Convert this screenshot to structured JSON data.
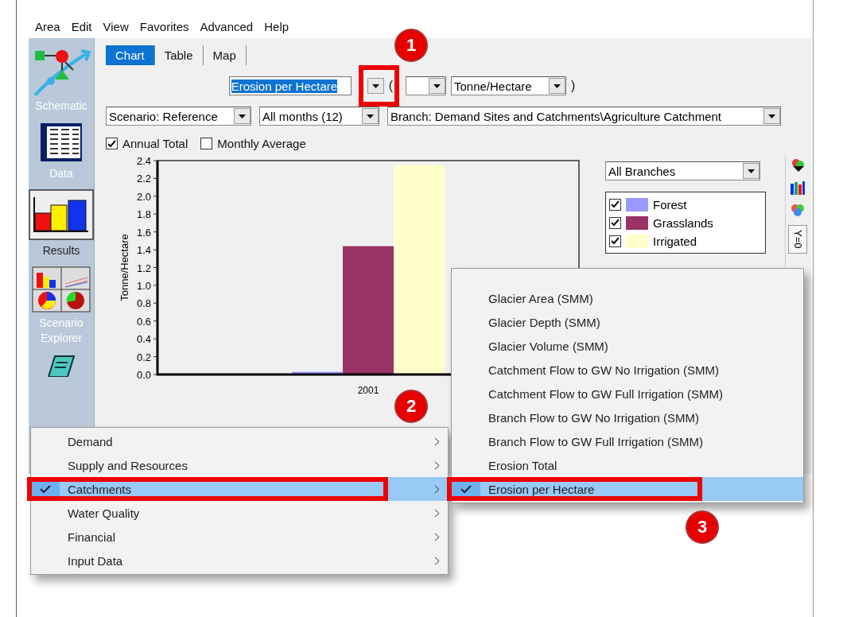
{
  "menu_bar": [
    "Area",
    "Edit",
    "View",
    "Favorites",
    "Advanced",
    "Help"
  ],
  "sidebar": [
    {
      "label": "Schematic",
      "selected": false,
      "kind": "schematic"
    },
    {
      "label": "Data",
      "selected": false,
      "kind": "data"
    },
    {
      "label": "Results",
      "selected": true,
      "kind": "results"
    },
    {
      "label": "Scenario Explorer",
      "selected": false,
      "kind": "explorer"
    }
  ],
  "tabs": [
    {
      "label": "Chart",
      "selected": true
    },
    {
      "label": "Table",
      "selected": false
    },
    {
      "label": "Map",
      "selected": false
    }
  ],
  "variable": {
    "value": "Erosion per Hectare"
  },
  "open_paren": "(",
  "unit": {
    "value": "Tonne/Hectare"
  },
  "close_paren": ")",
  "filters": [
    {
      "value": "Scenario: Reference"
    },
    {
      "value": "All months (12)"
    },
    {
      "value": "Branch: Demand Sites and Catchments\\Agriculture Catchment"
    }
  ],
  "options": [
    {
      "label": "Annual Total",
      "checked": true
    },
    {
      "label": "Monthly Average",
      "checked": false
    }
  ],
  "chart": {
    "chart_data": {
      "type": "bar",
      "ylabel": "Tonne/Hectare",
      "categories": [
        "2001"
      ],
      "series": [
        {
          "name": "Forest",
          "color": "#9999ff",
          "values": [
            0.03
          ]
        },
        {
          "name": "Grasslands",
          "color": "#993366",
          "values": [
            1.44
          ]
        },
        {
          "name": "Irrigated",
          "color": "#ffffcc",
          "values": [
            2.35
          ]
        }
      ],
      "ylim": [
        0,
        2.4
      ],
      "yticks": [
        {
          "value": 0,
          "label": "0.0"
        },
        {
          "value": 0.2,
          "label": "0.2"
        },
        {
          "value": 0.4,
          "label": "0.4"
        },
        {
          "value": 0.6,
          "label": "0.6"
        },
        {
          "value": 0.8,
          "label": "0.8"
        },
        {
          "value": 1,
          "label": "1.0"
        },
        {
          "value": 1.2,
          "label": "1.2"
        },
        {
          "value": 1.4,
          "label": "1.4"
        },
        {
          "value": 1.6,
          "label": "1.6"
        },
        {
          "value": 1.8,
          "label": "1.8"
        },
        {
          "value": 2,
          "label": "2.0"
        },
        {
          "value": 2.2,
          "label": "2.2"
        },
        {
          "value": 2.4,
          "label": "2.4"
        }
      ]
    }
  },
  "branch_filter": {
    "value": "All Branches"
  },
  "legend": [
    {
      "checked": true
    },
    {
      "checked": true
    },
    {
      "checked": true
    }
  ],
  "side_tab": "Y=0",
  "category_menu": [
    {
      "label": "Demand",
      "selected": false
    },
    {
      "label": "Supply and Resources",
      "selected": false
    },
    {
      "label": "Catchments",
      "selected": true
    },
    {
      "label": "Water Quality",
      "selected": false
    },
    {
      "label": "Financial",
      "selected": false
    },
    {
      "label": "Input Data",
      "selected": false
    }
  ],
  "variable_menu": [
    {
      "label": "Glacier Area (SMM)",
      "selected": false
    },
    {
      "label": "Glacier Depth (SMM)",
      "selected": false
    },
    {
      "label": "Glacier Volume (SMM)",
      "selected": false
    },
    {
      "label": "Catchment Flow to GW No Irrigation (SMM)",
      "selected": false
    },
    {
      "label": "Catchment Flow to GW Full Irrigation (SMM)",
      "selected": false
    },
    {
      "label": "Branch Flow to GW No Irrigation (SMM)",
      "selected": false
    },
    {
      "label": "Branch Flow to GW Full Irrigation (SMM)",
      "selected": false
    },
    {
      "label": "Erosion Total",
      "selected": false
    },
    {
      "label": "Erosion per Hectare",
      "selected": true
    }
  ],
  "annotations": [
    "1",
    "2",
    "3"
  ]
}
